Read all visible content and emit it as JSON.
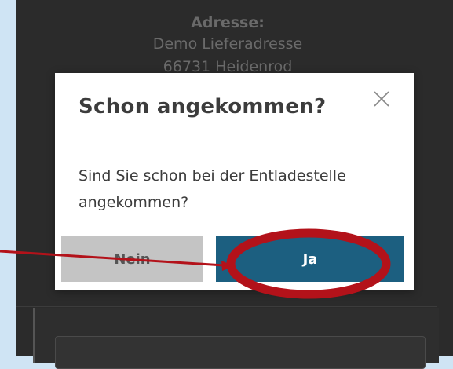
{
  "background": {
    "address_title": "Adresse:",
    "address_name": "Demo Lieferadresse",
    "address_partial": "66731 Heidenrod"
  },
  "dialog": {
    "title": "Schon angekommen?",
    "message": "Sind Sie schon bei der Entladestelle angekommen?",
    "close_icon": "close-icon",
    "no_label": "Nein",
    "yes_label": "Ja"
  },
  "annotation": {
    "type": "arrow-and-ellipse",
    "target": "yes_button",
    "color": "#b3121a"
  },
  "colors": {
    "page_background": "#cfe4f4",
    "overlay": "#2b2b2b",
    "primary_button": "#1c5f80",
    "secondary_button": "#c4c4c4",
    "text": "#3c3c3c"
  }
}
